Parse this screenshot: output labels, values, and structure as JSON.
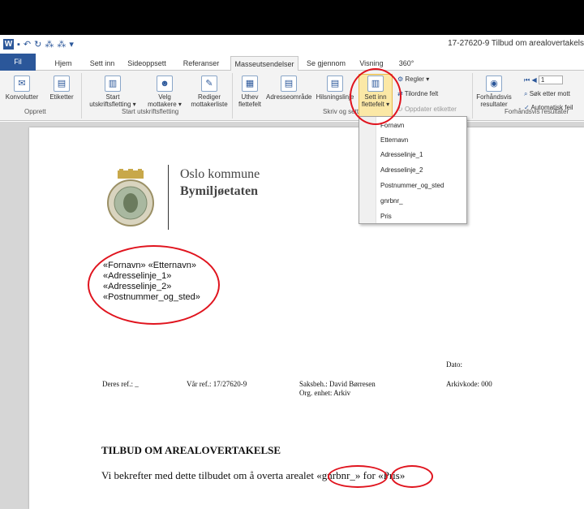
{
  "window": {
    "title": "17-27620-9 Tilbud om arealovertakels"
  },
  "tabs": [
    "Fil",
    "Hjem",
    "Sett inn",
    "Sideoppsett",
    "Referanser",
    "Masseutsendelser",
    "Se gjennom",
    "Visning",
    "360°"
  ],
  "ribbon": {
    "buttons": {
      "konvolutter": "Konvolutter",
      "etiketter": "Etiketter",
      "start": "Start",
      "start2": "utskriftsfletting",
      "velg": "Velg",
      "velg2": "mottakere",
      "rediger": "Rediger",
      "rediger2": "mottakerliste",
      "uthev": "Uthev",
      "uthev2": "flettefelt",
      "adresse": "Adresseområde",
      "hilsning": "Hilsningslinje",
      "settinn": "Sett inn",
      "settinn2": "flettefelt",
      "regler": "Regler",
      "tilordne": "Tilordne felt",
      "oppdater": "Oppdater etiketter",
      "forhand": "Forhåndsvis",
      "forhand2": "resultater",
      "sok": "Søk etter mott",
      "auto": "Automatisk feil",
      "record": "1"
    },
    "groups": {
      "opprett": "Opprett",
      "start": "Start utskriftsfletting",
      "skriv": "Skriv og sett",
      "forhand": "Forhåndsvis resultater"
    }
  },
  "dropdown": {
    "items": [
      "Fornavn",
      "Etternavn",
      "Adresselinje_1",
      "Adresselinje_2",
      "Postnummer_og_sted",
      "gnrbnr_",
      "Pris"
    ]
  },
  "document": {
    "org_line1": "Oslo kommune",
    "org_line2": "Bymiljøetaten",
    "address": [
      "«Fornavn» «Etternavn»",
      "«Adresselinje_1»",
      "«Adresselinje_2»",
      "«Postnummer_og_sted»"
    ],
    "deres_ref": "Deres ref.: _",
    "var_ref": "Vår ref.: 17/27620-9",
    "saksbeh": "Saksbeh.: David Børresen",
    "org_enhet": "Org. enhet: Arkiv",
    "dato": "Dato:",
    "arkivkode": "Arkivkode: 000",
    "heading": "TILBUD OM AREALOVERTAKELSE",
    "body_pre": "Vi bekrefter med dette tilbudet om å overta arealet ",
    "field_gnrbnr": "«gnrbnr_»",
    "body_mid": " for ",
    "field_pris": "«Pris»"
  },
  "colors": {
    "accent": "#2b579a",
    "annotation": "#e0141e",
    "highlight": "#fbe8a6"
  }
}
